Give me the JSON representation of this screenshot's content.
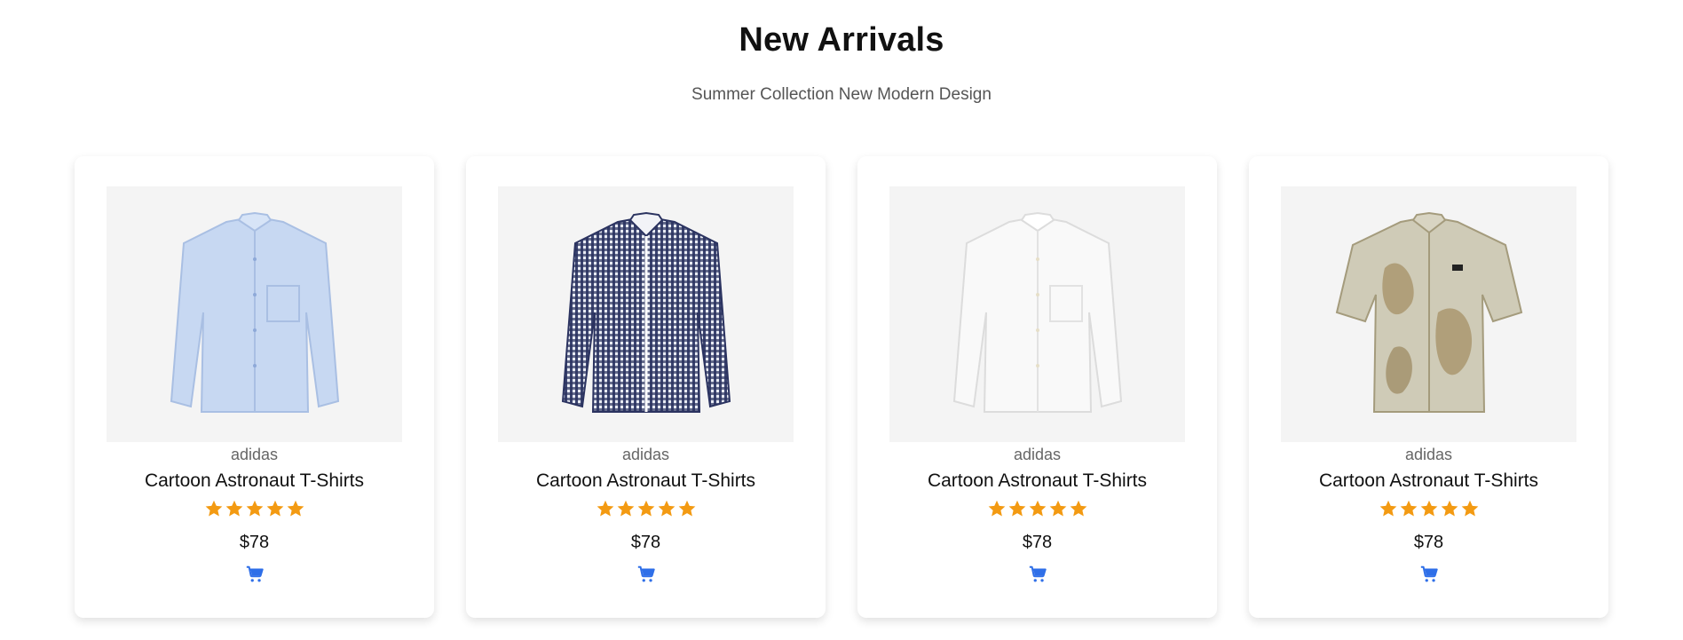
{
  "section": {
    "title": "New Arrivals",
    "subtitle": "Summer Collection New Modern Design"
  },
  "colors": {
    "star": "#F39A12",
    "cart": "#2F6FE8",
    "image_background": "#F4F4F4"
  },
  "products": [
    {
      "image_icon": "light-blue-shirt-image",
      "brand": "adidas",
      "name": "Cartoon Astronaut T-Shirts",
      "rating": 5,
      "price": "$78",
      "cart_icon": "cart-icon"
    },
    {
      "image_icon": "navy-check-shirt-image",
      "brand": "adidas",
      "name": "Cartoon Astronaut T-Shirts",
      "rating": 5,
      "price": "$78",
      "cart_icon": "cart-icon"
    },
    {
      "image_icon": "white-shirt-image",
      "brand": "adidas",
      "name": "Cartoon Astronaut T-Shirts",
      "rating": 5,
      "price": "$78",
      "cart_icon": "cart-icon"
    },
    {
      "image_icon": "printed-short-sleeve-shirt-image",
      "brand": "adidas",
      "name": "Cartoon Astronaut T-Shirts",
      "rating": 5,
      "price": "$78",
      "cart_icon": "cart-icon"
    }
  ]
}
